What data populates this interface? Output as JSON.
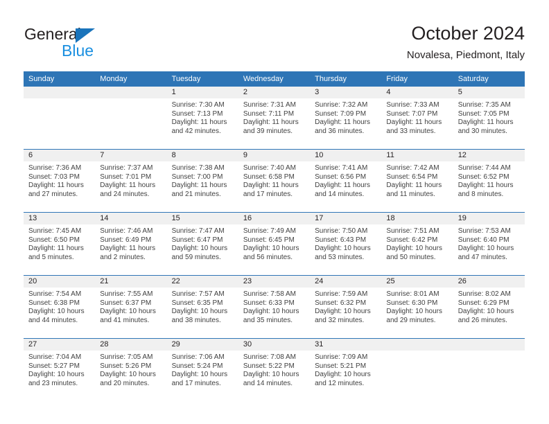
{
  "brand": {
    "name_part1": "General",
    "name_part2": "Blue",
    "flag_icon": "triangle-flag-icon",
    "accent_dark_blue": "#1a74bb",
    "accent_light_blue": "#1a8fe0"
  },
  "header": {
    "title": "October 2024",
    "subtitle": "Novalesa, Piedmont, Italy"
  },
  "theme": {
    "header_row_blue": "#2e75b6",
    "daynum_band_gray": "#f0f0f0",
    "body_text": "#404040"
  },
  "weekday_headers": [
    "Sunday",
    "Monday",
    "Tuesday",
    "Wednesday",
    "Thursday",
    "Friday",
    "Saturday"
  ],
  "weeks": [
    [
      {
        "day": "",
        "sunrise": "",
        "sunset": "",
        "daylight_line1": "",
        "daylight_line2": ""
      },
      {
        "day": "",
        "sunrise": "",
        "sunset": "",
        "daylight_line1": "",
        "daylight_line2": ""
      },
      {
        "day": "1",
        "sunrise": "Sunrise: 7:30 AM",
        "sunset": "Sunset: 7:13 PM",
        "daylight_line1": "Daylight: 11 hours",
        "daylight_line2": "and 42 minutes."
      },
      {
        "day": "2",
        "sunrise": "Sunrise: 7:31 AM",
        "sunset": "Sunset: 7:11 PM",
        "daylight_line1": "Daylight: 11 hours",
        "daylight_line2": "and 39 minutes."
      },
      {
        "day": "3",
        "sunrise": "Sunrise: 7:32 AM",
        "sunset": "Sunset: 7:09 PM",
        "daylight_line1": "Daylight: 11 hours",
        "daylight_line2": "and 36 minutes."
      },
      {
        "day": "4",
        "sunrise": "Sunrise: 7:33 AM",
        "sunset": "Sunset: 7:07 PM",
        "daylight_line1": "Daylight: 11 hours",
        "daylight_line2": "and 33 minutes."
      },
      {
        "day": "5",
        "sunrise": "Sunrise: 7:35 AM",
        "sunset": "Sunset: 7:05 PM",
        "daylight_line1": "Daylight: 11 hours",
        "daylight_line2": "and 30 minutes."
      }
    ],
    [
      {
        "day": "6",
        "sunrise": "Sunrise: 7:36 AM",
        "sunset": "Sunset: 7:03 PM",
        "daylight_line1": "Daylight: 11 hours",
        "daylight_line2": "and 27 minutes."
      },
      {
        "day": "7",
        "sunrise": "Sunrise: 7:37 AM",
        "sunset": "Sunset: 7:01 PM",
        "daylight_line1": "Daylight: 11 hours",
        "daylight_line2": "and 24 minutes."
      },
      {
        "day": "8",
        "sunrise": "Sunrise: 7:38 AM",
        "sunset": "Sunset: 7:00 PM",
        "daylight_line1": "Daylight: 11 hours",
        "daylight_line2": "and 21 minutes."
      },
      {
        "day": "9",
        "sunrise": "Sunrise: 7:40 AM",
        "sunset": "Sunset: 6:58 PM",
        "daylight_line1": "Daylight: 11 hours",
        "daylight_line2": "and 17 minutes."
      },
      {
        "day": "10",
        "sunrise": "Sunrise: 7:41 AM",
        "sunset": "Sunset: 6:56 PM",
        "daylight_line1": "Daylight: 11 hours",
        "daylight_line2": "and 14 minutes."
      },
      {
        "day": "11",
        "sunrise": "Sunrise: 7:42 AM",
        "sunset": "Sunset: 6:54 PM",
        "daylight_line1": "Daylight: 11 hours",
        "daylight_line2": "and 11 minutes."
      },
      {
        "day": "12",
        "sunrise": "Sunrise: 7:44 AM",
        "sunset": "Sunset: 6:52 PM",
        "daylight_line1": "Daylight: 11 hours",
        "daylight_line2": "and 8 minutes."
      }
    ],
    [
      {
        "day": "13",
        "sunrise": "Sunrise: 7:45 AM",
        "sunset": "Sunset: 6:50 PM",
        "daylight_line1": "Daylight: 11 hours",
        "daylight_line2": "and 5 minutes."
      },
      {
        "day": "14",
        "sunrise": "Sunrise: 7:46 AM",
        "sunset": "Sunset: 6:49 PM",
        "daylight_line1": "Daylight: 11 hours",
        "daylight_line2": "and 2 minutes."
      },
      {
        "day": "15",
        "sunrise": "Sunrise: 7:47 AM",
        "sunset": "Sunset: 6:47 PM",
        "daylight_line1": "Daylight: 10 hours",
        "daylight_line2": "and 59 minutes."
      },
      {
        "day": "16",
        "sunrise": "Sunrise: 7:49 AM",
        "sunset": "Sunset: 6:45 PM",
        "daylight_line1": "Daylight: 10 hours",
        "daylight_line2": "and 56 minutes."
      },
      {
        "day": "17",
        "sunrise": "Sunrise: 7:50 AM",
        "sunset": "Sunset: 6:43 PM",
        "daylight_line1": "Daylight: 10 hours",
        "daylight_line2": "and 53 minutes."
      },
      {
        "day": "18",
        "sunrise": "Sunrise: 7:51 AM",
        "sunset": "Sunset: 6:42 PM",
        "daylight_line1": "Daylight: 10 hours",
        "daylight_line2": "and 50 minutes."
      },
      {
        "day": "19",
        "sunrise": "Sunrise: 7:53 AM",
        "sunset": "Sunset: 6:40 PM",
        "daylight_line1": "Daylight: 10 hours",
        "daylight_line2": "and 47 minutes."
      }
    ],
    [
      {
        "day": "20",
        "sunrise": "Sunrise: 7:54 AM",
        "sunset": "Sunset: 6:38 PM",
        "daylight_line1": "Daylight: 10 hours",
        "daylight_line2": "and 44 minutes."
      },
      {
        "day": "21",
        "sunrise": "Sunrise: 7:55 AM",
        "sunset": "Sunset: 6:37 PM",
        "daylight_line1": "Daylight: 10 hours",
        "daylight_line2": "and 41 minutes."
      },
      {
        "day": "22",
        "sunrise": "Sunrise: 7:57 AM",
        "sunset": "Sunset: 6:35 PM",
        "daylight_line1": "Daylight: 10 hours",
        "daylight_line2": "and 38 minutes."
      },
      {
        "day": "23",
        "sunrise": "Sunrise: 7:58 AM",
        "sunset": "Sunset: 6:33 PM",
        "daylight_line1": "Daylight: 10 hours",
        "daylight_line2": "and 35 minutes."
      },
      {
        "day": "24",
        "sunrise": "Sunrise: 7:59 AM",
        "sunset": "Sunset: 6:32 PM",
        "daylight_line1": "Daylight: 10 hours",
        "daylight_line2": "and 32 minutes."
      },
      {
        "day": "25",
        "sunrise": "Sunrise: 8:01 AM",
        "sunset": "Sunset: 6:30 PM",
        "daylight_line1": "Daylight: 10 hours",
        "daylight_line2": "and 29 minutes."
      },
      {
        "day": "26",
        "sunrise": "Sunrise: 8:02 AM",
        "sunset": "Sunset: 6:29 PM",
        "daylight_line1": "Daylight: 10 hours",
        "daylight_line2": "and 26 minutes."
      }
    ],
    [
      {
        "day": "27",
        "sunrise": "Sunrise: 7:04 AM",
        "sunset": "Sunset: 5:27 PM",
        "daylight_line1": "Daylight: 10 hours",
        "daylight_line2": "and 23 minutes."
      },
      {
        "day": "28",
        "sunrise": "Sunrise: 7:05 AM",
        "sunset": "Sunset: 5:26 PM",
        "daylight_line1": "Daylight: 10 hours",
        "daylight_line2": "and 20 minutes."
      },
      {
        "day": "29",
        "sunrise": "Sunrise: 7:06 AM",
        "sunset": "Sunset: 5:24 PM",
        "daylight_line1": "Daylight: 10 hours",
        "daylight_line2": "and 17 minutes."
      },
      {
        "day": "30",
        "sunrise": "Sunrise: 7:08 AM",
        "sunset": "Sunset: 5:22 PM",
        "daylight_line1": "Daylight: 10 hours",
        "daylight_line2": "and 14 minutes."
      },
      {
        "day": "31",
        "sunrise": "Sunrise: 7:09 AM",
        "sunset": "Sunset: 5:21 PM",
        "daylight_line1": "Daylight: 10 hours",
        "daylight_line2": "and 12 minutes."
      },
      {
        "day": "",
        "sunrise": "",
        "sunset": "",
        "daylight_line1": "",
        "daylight_line2": ""
      },
      {
        "day": "",
        "sunrise": "",
        "sunset": "",
        "daylight_line1": "",
        "daylight_line2": ""
      }
    ]
  ]
}
